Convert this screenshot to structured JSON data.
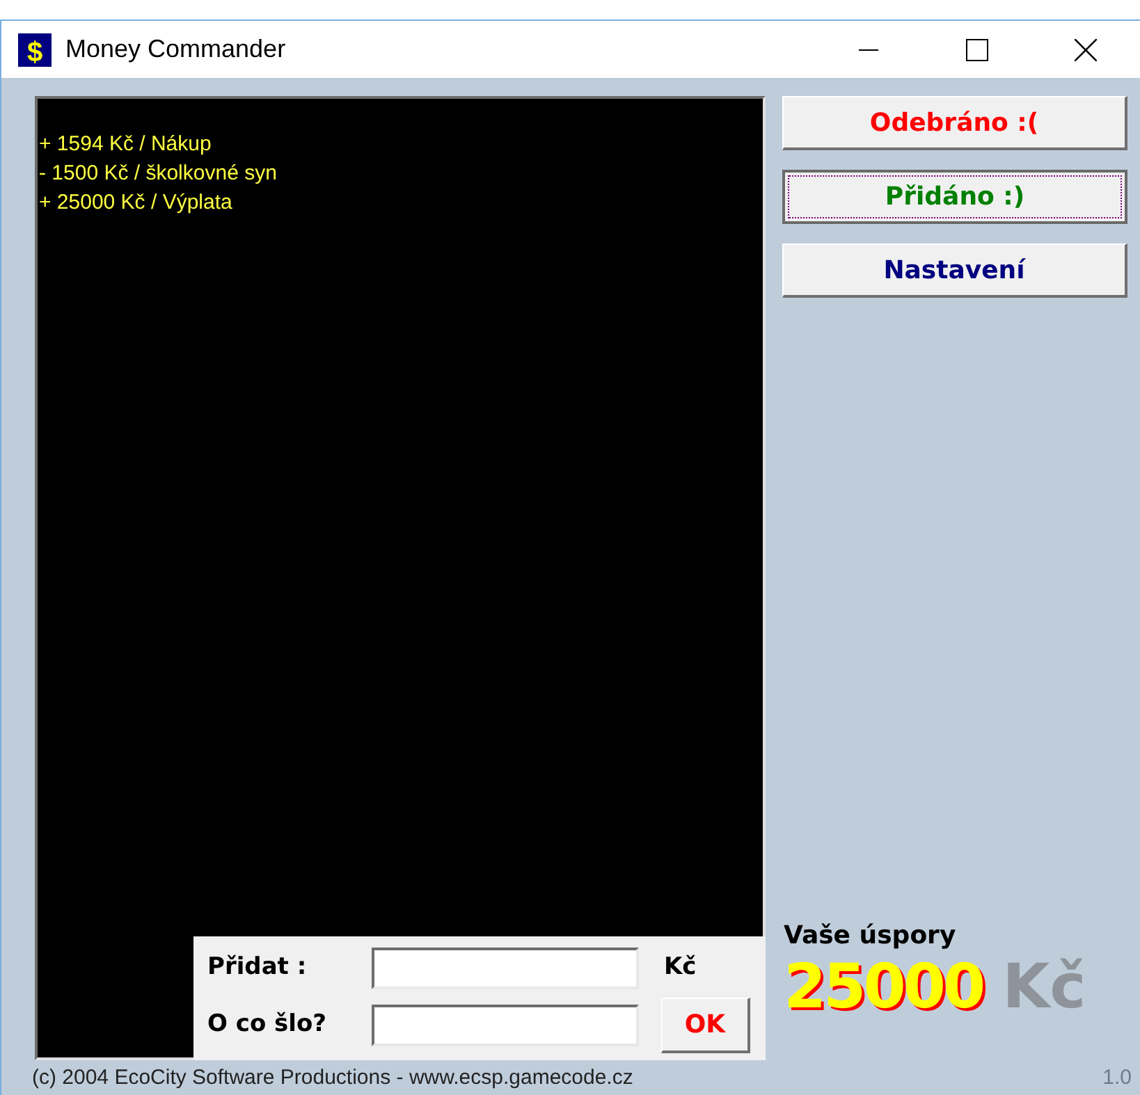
{
  "window": {
    "icon_glyph": "$",
    "title": "Money Commander"
  },
  "log": [
    "+ 1594 Kč / Nákup",
    "- 1500 Kč / školkovné syn",
    "+ 25000 Kč / Výplata"
  ],
  "buttons": [
    {
      "label": "Odebráno :(",
      "color": "#ff0000",
      "focused": false
    },
    {
      "label": "Přidáno :)",
      "color": "#008000",
      "focused": true
    },
    {
      "label": "Nastavení",
      "color": "#000080",
      "focused": false
    }
  ],
  "form": {
    "amount_label": "Přidat :",
    "currency": "Kč",
    "note_label": "O co šlo?",
    "ok": "OK"
  },
  "savings": {
    "label": "Vaše úspory",
    "amount": "25000",
    "currency": "Kč"
  },
  "status_bar": {
    "copyright": "(c) 2004 EcoCity Software Productions - www.ecsp.gamecode.cz",
    "version": "1.0"
  }
}
